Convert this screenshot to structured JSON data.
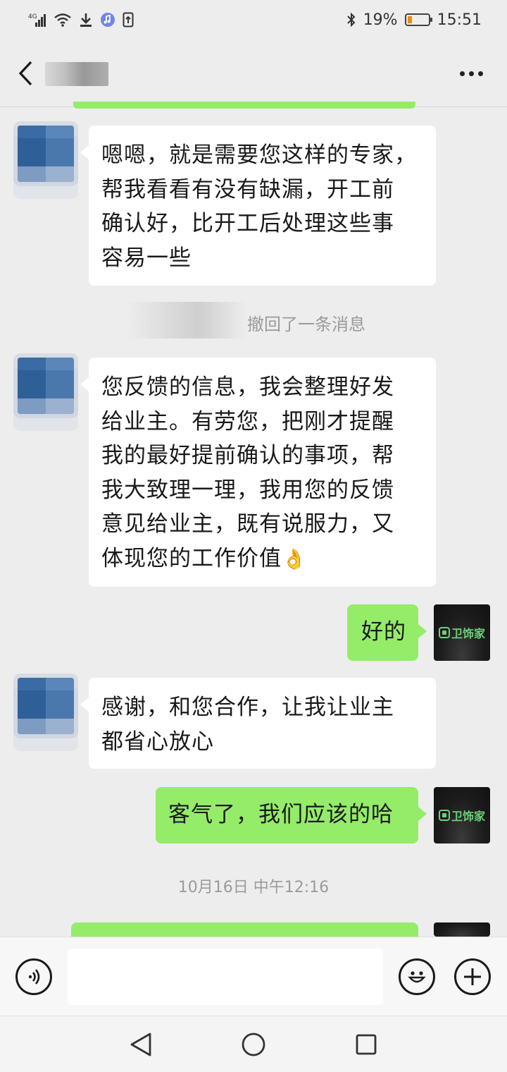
{
  "status_bar": {
    "signal": "4G",
    "battery_percent": "19%",
    "time": "15:51",
    "icons": [
      "signal-icon",
      "wifi-icon",
      "download-icon",
      "music-icon",
      "upload-icon",
      "bluetooth-icon",
      "battery-icon"
    ],
    "battery_color": "#f08a00"
  },
  "header": {
    "back_icon": "chevron-left-icon",
    "more_icon": "more-dots-icon"
  },
  "messages": [
    {
      "from": "other",
      "text": "嗯嗯，就是需要您这样的专家，\n帮我看看有没有缺漏，开工前\n确认好，比开工后处理这些事\n容易一些"
    },
    {
      "type": "system",
      "text": "撤回了一条消息"
    },
    {
      "from": "other",
      "text": "您反馈的信息，我会整理好发\n给业主。有劳您，把刚才提醒\n我的最好提前确认的事项，帮\n我大致理一理，我用您的反馈\n意见给业主，既有说服力，又\n体现您的工作价值",
      "emoji": "👌"
    },
    {
      "from": "self",
      "text": "好的"
    },
    {
      "from": "other",
      "text": "感谢，和您合作，让我让业主\n都省心放心"
    },
    {
      "from": "self",
      "text": "客气了，我们应该的哈"
    },
    {
      "type": "timestamp",
      "text": "10月16日 中午12:16"
    }
  ],
  "self_avatar": {
    "logo_text": "卫饰家",
    "logo_color": "#6ed07a"
  },
  "input_bar": {
    "voice_icon": "voice-icon",
    "emoji_icon": "emoji-icon",
    "plus_icon": "plus-icon",
    "input_value": ""
  },
  "nav_bar": {
    "icons": [
      "back-triangle-icon",
      "home-circle-icon",
      "recent-square-icon"
    ]
  },
  "colors": {
    "self_bubble": "#95ec69",
    "other_bubble": "#ffffff",
    "background": "#ededed"
  }
}
